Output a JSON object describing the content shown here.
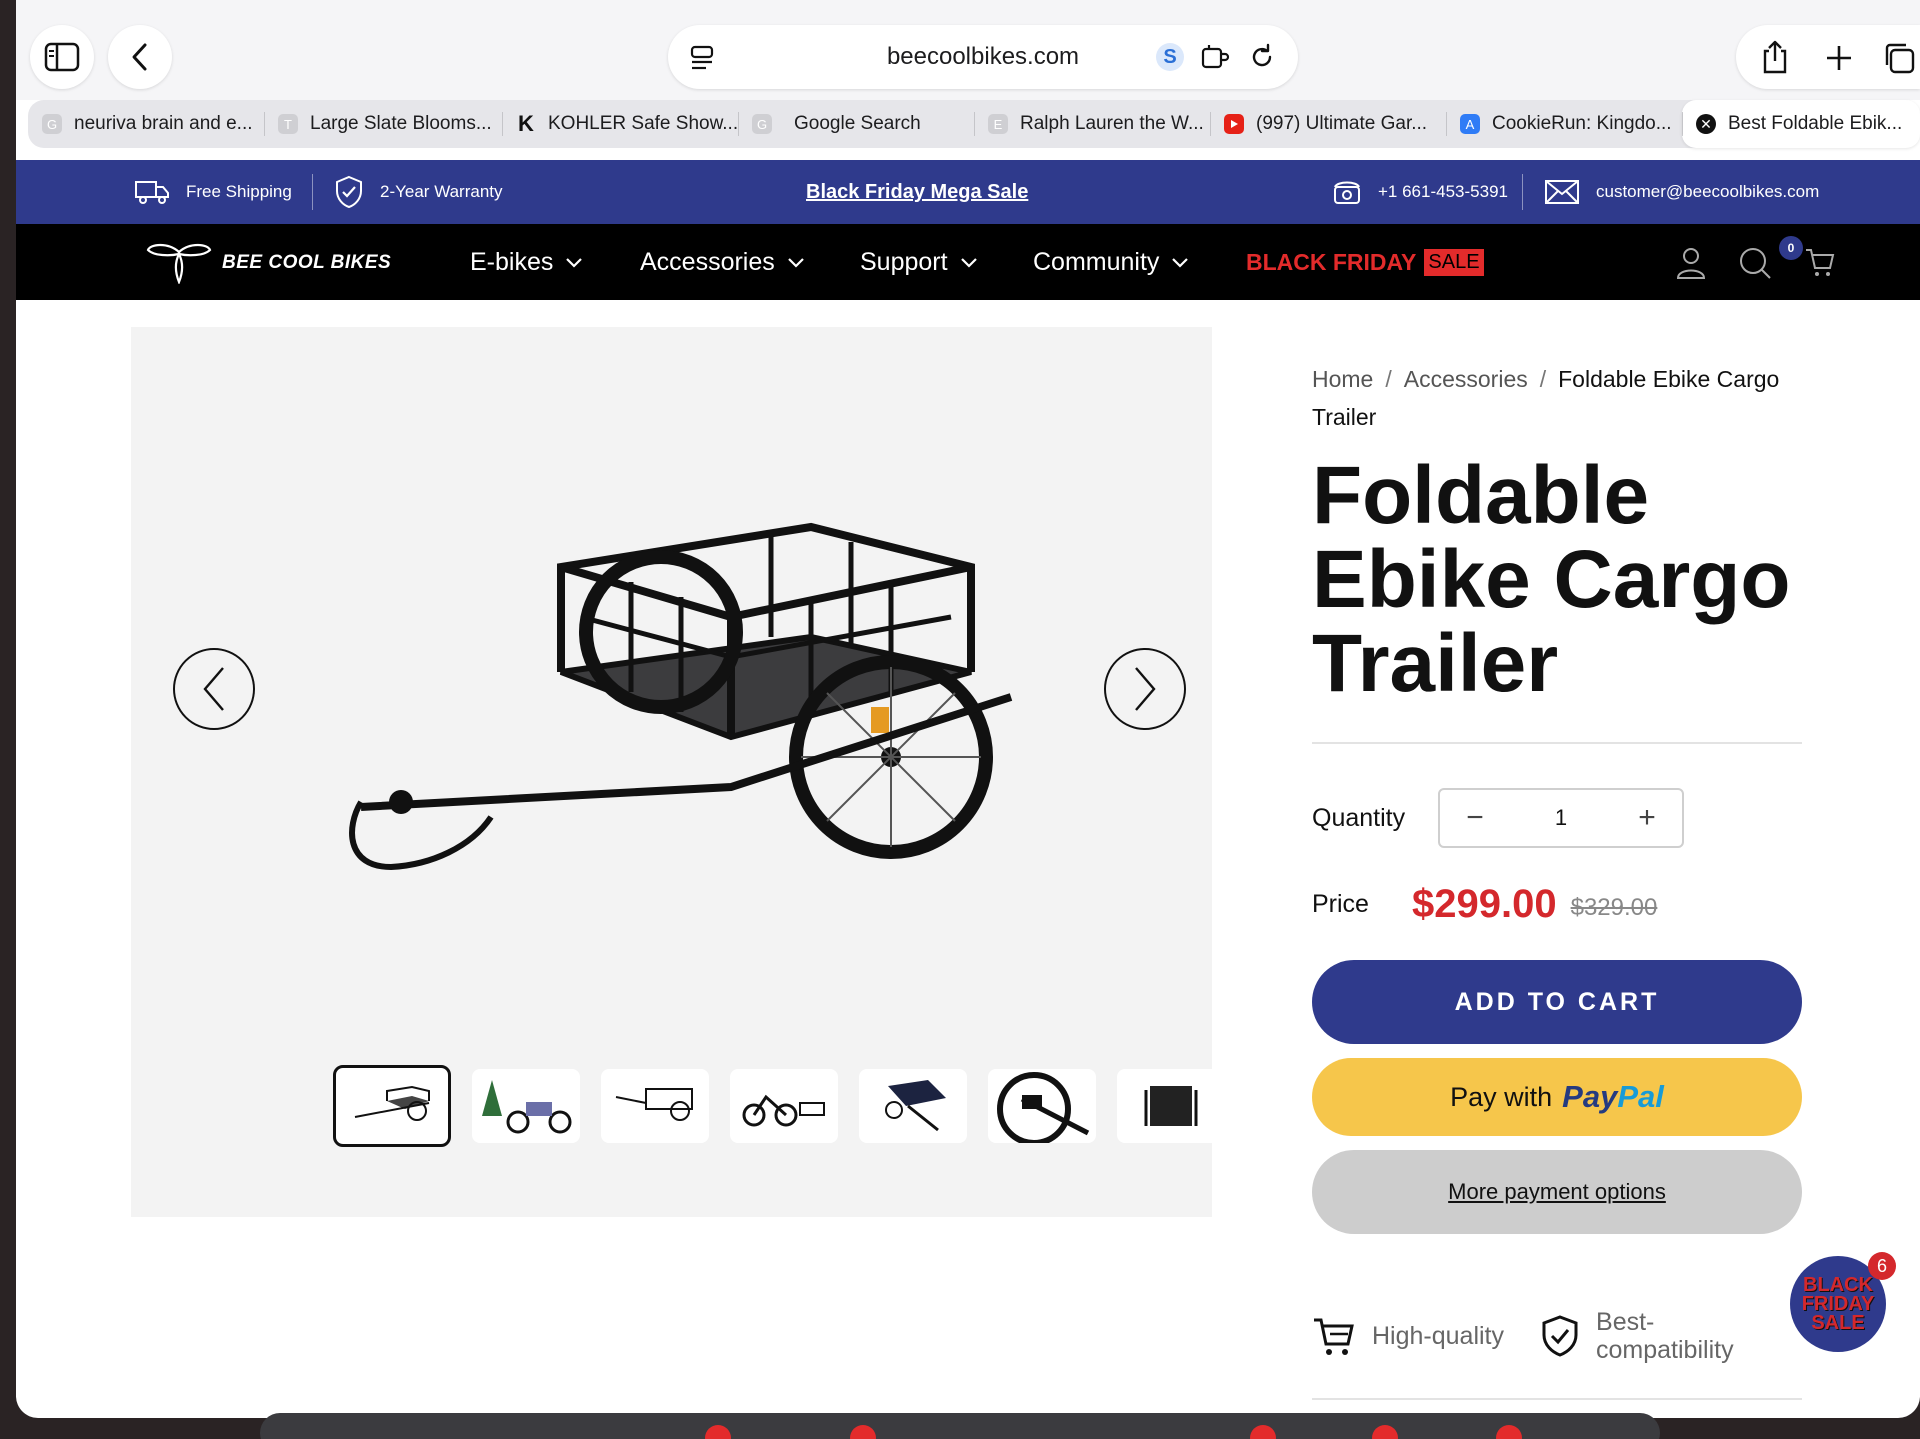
{
  "browser": {
    "url": "beecoolbikes.com",
    "tabs": [
      {
        "label": "neuriva brain and e...",
        "favicon": "G"
      },
      {
        "label": "Large Slate Blooms...",
        "favicon": "T"
      },
      {
        "label": "KOHLER Safe Show...",
        "favicon": "K"
      },
      {
        "label": "Google Search",
        "favicon": "G"
      },
      {
        "label": "Ralph Lauren the W...",
        "favicon": "E"
      },
      {
        "label": "(997) Ultimate Gar...",
        "favicon": "youtube-icon"
      },
      {
        "label": "CookieRun: Kingdo...",
        "favicon": "app-store-icon"
      },
      {
        "label": "Best Foldable Ebik...",
        "favicon": "close-icon"
      }
    ],
    "active_tab": 7
  },
  "announcement": {
    "shipping": "Free Shipping",
    "warranty": "2-Year Warranty",
    "promo": "Black Friday Mega Sale",
    "phone": "+1 661-453-5391",
    "email": "customer@beecoolbikes.com"
  },
  "nav": {
    "brand": "BEE COOL BIKES",
    "items": [
      "E-bikes",
      "Accessories",
      "Support",
      "Community"
    ],
    "black_friday": "BLACK FRIDAY",
    "sale_tag": "SALE",
    "cart_count": "0"
  },
  "breadcrumb": {
    "home": "Home",
    "category": "Accessories",
    "current": "Foldable Ebike Cargo Trailer"
  },
  "product": {
    "title": "Foldable Ebike Cargo Trailer",
    "quantity_label": "Quantity",
    "quantity": "1",
    "price_label": "Price",
    "price": "$299.00",
    "compare_price": "$329.00",
    "add_to_cart": "ADD TO CART",
    "paypal_prefix": "Pay with",
    "paypal_brand_a": "Pay",
    "paypal_brand_b": "Pal",
    "more_payment": "More payment options",
    "features": [
      "High-quality",
      "Best-compatibility"
    ],
    "thumbnail_count": 7
  },
  "badge": {
    "line1": "BLACK",
    "line2": "FRIDAY",
    "line3": "SALE",
    "count": "6"
  },
  "colors": {
    "brand_blue": "#2f3a8c",
    "sale_red": "#d4282c",
    "paypal_yellow": "#f6c64b"
  }
}
